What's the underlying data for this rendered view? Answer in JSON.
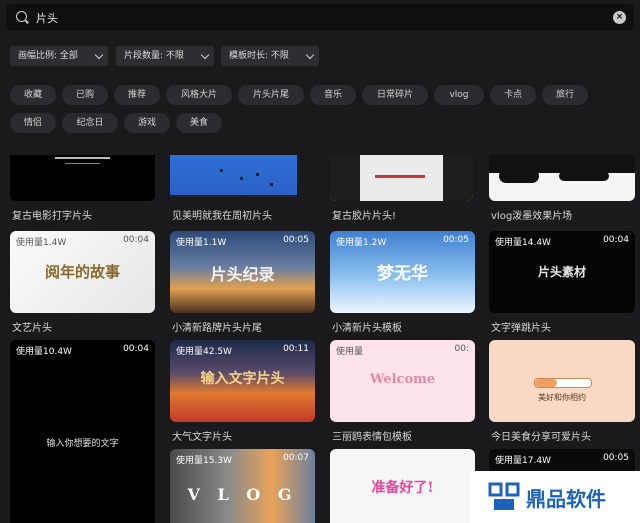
{
  "search": {
    "value": "片头",
    "clear_icon": "×"
  },
  "filters": [
    {
      "label": "画幅比例: 全部"
    },
    {
      "label": "片段数量: 不限"
    },
    {
      "label": "模板时长: 不限"
    }
  ],
  "tags_row1": [
    "收藏",
    "已购",
    "推荐",
    "风格大片",
    "片头片尾",
    "音乐",
    "日常碎片",
    "vlog",
    "卡点",
    "旅行"
  ],
  "tags_row2": [
    "情侣",
    "纪念日",
    "游戏",
    "美食"
  ],
  "templates": [
    {
      "title": "复古电影打字片头",
      "uses": "",
      "duration": ""
    },
    {
      "title": "见美明就我在周初片头",
      "uses": "",
      "duration": ""
    },
    {
      "title": "复古胶片片头!",
      "uses": "",
      "duration": ""
    },
    {
      "title": "vlog泼墨效果片场",
      "uses": "",
      "duration": ""
    },
    {
      "title": "文艺片头",
      "uses": "使用量1.4W",
      "duration": "00:04",
      "art": "阅年的故事"
    },
    {
      "title": "小清新路牌片头片尾",
      "uses": "使用量1.1W",
      "duration": "00:05",
      "art": "片头纪录"
    },
    {
      "title": "小清新片头模板",
      "uses": "使用量1.2W",
      "duration": "00:05",
      "art": "梦无华"
    },
    {
      "title": "文字弹跳片头",
      "uses": "使用量14.4W",
      "duration": "00:04",
      "art": "片头素材"
    },
    {
      "title": "",
      "uses": "使用量10.4W",
      "duration": "00:04",
      "art": "输入你想要的文字"
    },
    {
      "title": "大气文字片头",
      "uses": "使用量42.5W",
      "duration": "00:11",
      "art": "输入文字片头"
    },
    {
      "title": "三丽鸥表情包模板",
      "uses": "使用量",
      "duration": "00:",
      "art": "Welcome"
    },
    {
      "title": "今日美食分享可爱片头",
      "uses": "",
      "duration": "",
      "art": "美好和你相约"
    },
    {
      "title": "",
      "uses": "使用量15.3W",
      "duration": "00:07",
      "art": "V L O G"
    },
    {
      "title": "",
      "uses": "",
      "duration": "",
      "art": "准备好了!"
    },
    {
      "title": "",
      "uses": "使用量17.4W",
      "duration": "00:05",
      "art": ""
    }
  ],
  "watermark": {
    "text": "鼎品软件"
  },
  "colors": {
    "background": "#1a1a1d",
    "chip": "#2c2c30",
    "watermark_blue": "#1b63b8"
  }
}
